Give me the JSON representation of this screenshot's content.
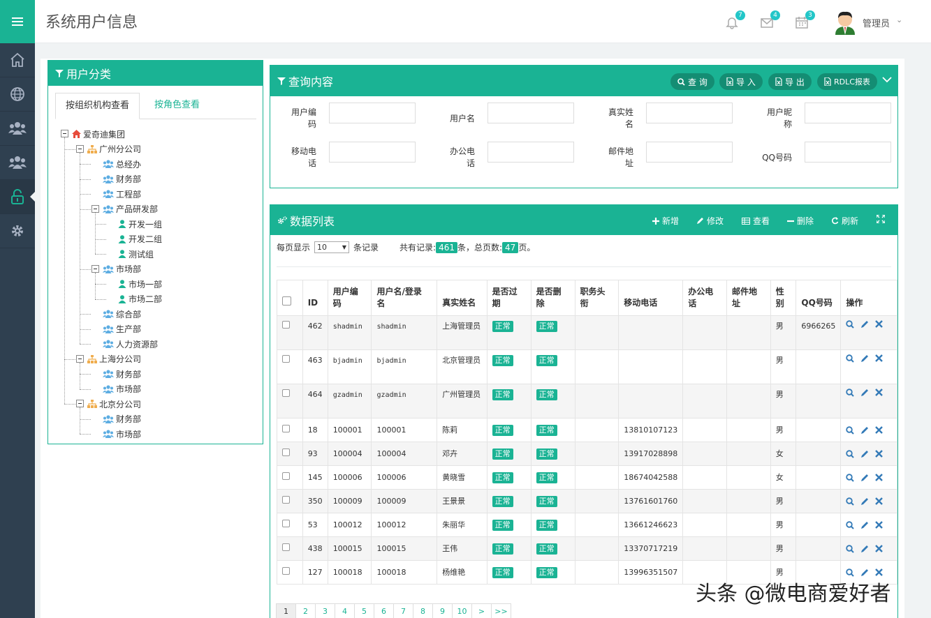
{
  "header": {
    "title": "系统用户信息",
    "notifications": [
      {
        "icon": "bell-icon",
        "count": "7"
      },
      {
        "icon": "mail-icon",
        "count": "4"
      },
      {
        "icon": "calendar-icon",
        "count": "3"
      }
    ],
    "user": {
      "name": "管理员",
      "caret": "⌄"
    }
  },
  "sidebar": {
    "items": [
      {
        "icon": "home-icon"
      },
      {
        "icon": "globe-icon"
      },
      {
        "icon": "users-icon"
      },
      {
        "icon": "group-icon"
      },
      {
        "icon": "lock-icon"
      },
      {
        "icon": "gear-icon"
      }
    ],
    "active_index": 4
  },
  "tree_panel": {
    "title": "用户分类",
    "tabs": [
      "按组织机构查看",
      "按角色查看"
    ],
    "nodes": [
      {
        "label": "爱奇迪集团",
        "type": "root"
      },
      {
        "label": "广州分公司",
        "type": "company"
      },
      {
        "label": "总经办",
        "type": "dept"
      },
      {
        "label": "财务部",
        "type": "dept"
      },
      {
        "label": "工程部",
        "type": "dept"
      },
      {
        "label": "产品研发部",
        "type": "dept"
      },
      {
        "label": "开发一组",
        "type": "team"
      },
      {
        "label": "开发二组",
        "type": "team"
      },
      {
        "label": "测试组",
        "type": "team"
      },
      {
        "label": "市场部",
        "type": "dept"
      },
      {
        "label": "市场一部",
        "type": "team"
      },
      {
        "label": "市场二部",
        "type": "team"
      },
      {
        "label": "综合部",
        "type": "dept"
      },
      {
        "label": "生产部",
        "type": "dept"
      },
      {
        "label": "人力资源部",
        "type": "dept"
      },
      {
        "label": "上海分公司",
        "type": "company"
      },
      {
        "label": "财务部",
        "type": "dept"
      },
      {
        "label": "市场部",
        "type": "dept"
      },
      {
        "label": "北京分公司",
        "type": "company"
      },
      {
        "label": "财务部",
        "type": "dept"
      },
      {
        "label": "市场部",
        "type": "dept"
      }
    ]
  },
  "query_panel": {
    "title": "查询内容",
    "buttons": [
      "查 询",
      "导 入",
      "导 出",
      "RDLC报表"
    ],
    "fields": [
      {
        "label": "用户编码",
        "lines": [
          "用户编",
          "码"
        ]
      },
      {
        "label": "用户名",
        "lines": [
          "用户名"
        ]
      },
      {
        "label": "真实姓名",
        "lines": [
          "真实姓",
          "名"
        ]
      },
      {
        "label": "用户昵称",
        "lines": [
          "用户昵",
          "称"
        ]
      },
      {
        "label": "移动电话",
        "lines": [
          "移动电",
          "话"
        ]
      },
      {
        "label": "办公电话",
        "lines": [
          "办公电",
          "话"
        ]
      },
      {
        "label": "邮件地址",
        "lines": [
          "邮件地",
          "址"
        ]
      },
      {
        "label": "QQ号码",
        "lines": [
          "QQ号码"
        ]
      }
    ]
  },
  "data_panel": {
    "title": "数据列表",
    "tools": [
      "新增",
      "修改",
      "查看",
      "删除",
      "刷新"
    ],
    "page_size_prefix": "每页显示",
    "page_size": "10",
    "page_size_suffix": "条记录",
    "total_prefix": "共有记录:",
    "total_records": "461",
    "total_mid": "条，总页数:",
    "total_pages": "47",
    "total_suffix": "页。",
    "columns": [
      [
        "ID"
      ],
      [
        "用户编",
        "码"
      ],
      [
        "用户名/登录",
        "名"
      ],
      [
        "真实姓名"
      ],
      [
        "是否过",
        "期"
      ],
      [
        "是否删",
        "除"
      ],
      [
        "职务头",
        "衔"
      ],
      [
        "移动电话"
      ],
      [
        "办公电",
        "话"
      ],
      [
        "邮件地",
        "址"
      ],
      [
        "性",
        "别"
      ],
      [
        "QQ号码"
      ],
      [
        "操作"
      ]
    ],
    "rows": [
      {
        "id": "462",
        "code": "shadmin",
        "login": "shadmin",
        "name": "上海管理员",
        "expired": "正常",
        "deleted": "正常",
        "title": "",
        "mobile": "",
        "office": "",
        "email": "",
        "gender": "男",
        "qq": "6966265"
      },
      {
        "id": "463",
        "code": "bjadmin",
        "login": "bjadmin",
        "name": "北京管理员",
        "expired": "正常",
        "deleted": "正常",
        "title": "",
        "mobile": "",
        "office": "",
        "email": "",
        "gender": "男",
        "qq": ""
      },
      {
        "id": "464",
        "code": "gzadmin",
        "login": "gzadmin",
        "name": "广州管理员",
        "expired": "正常",
        "deleted": "正常",
        "title": "",
        "mobile": "",
        "office": "",
        "email": "",
        "gender": "男",
        "qq": ""
      },
      {
        "id": "18",
        "code": "100001",
        "login": "100001",
        "name": "陈莉",
        "expired": "正常",
        "deleted": "正常",
        "title": "",
        "mobile": "13810107123",
        "office": "",
        "email": "",
        "gender": "男",
        "qq": ""
      },
      {
        "id": "93",
        "code": "100004",
        "login": "100004",
        "name": "邓卉",
        "expired": "正常",
        "deleted": "正常",
        "title": "",
        "mobile": "13917028898",
        "office": "",
        "email": "",
        "gender": "女",
        "qq": ""
      },
      {
        "id": "145",
        "code": "100006",
        "login": "100006",
        "name": "黄晓雪",
        "expired": "正常",
        "deleted": "正常",
        "title": "",
        "mobile": "18674042588",
        "office": "",
        "email": "",
        "gender": "女",
        "qq": ""
      },
      {
        "id": "350",
        "code": "100009",
        "login": "100009",
        "name": "王景景",
        "expired": "正常",
        "deleted": "正常",
        "title": "",
        "mobile": "13761601760",
        "office": "",
        "email": "",
        "gender": "男",
        "qq": ""
      },
      {
        "id": "53",
        "code": "100012",
        "login": "100012",
        "name": "朱丽华",
        "expired": "正常",
        "deleted": "正常",
        "title": "",
        "mobile": "13661246623",
        "office": "",
        "email": "",
        "gender": "男",
        "qq": ""
      },
      {
        "id": "438",
        "code": "100015",
        "login": "100015",
        "name": "王伟",
        "expired": "正常",
        "deleted": "正常",
        "title": "",
        "mobile": "13370717219",
        "office": "",
        "email": "",
        "gender": "男",
        "qq": ""
      },
      {
        "id": "127",
        "code": "100018",
        "login": "100018",
        "name": "杨维艳",
        "expired": "正常",
        "deleted": "正常",
        "title": "",
        "mobile": "13996351507",
        "office": "",
        "email": "",
        "gender": "男",
        "qq": ""
      }
    ],
    "pages": [
      "1",
      "2",
      "3",
      "4",
      "5",
      "6",
      "7",
      "8",
      "9",
      "10",
      ">",
      ">>"
    ],
    "current_page": "1"
  },
  "watermark": "头条 @微电商爱好者",
  "colors": {
    "accent": "#1ab394",
    "sidebar": "#2f4050",
    "badge": "#23c6c8",
    "link": "#337ab7"
  }
}
